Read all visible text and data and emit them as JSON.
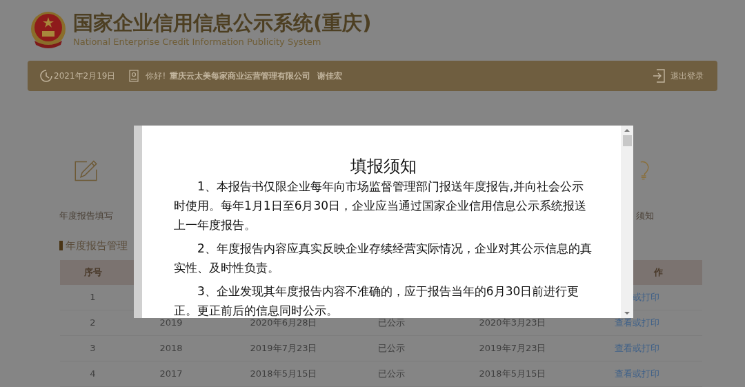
{
  "header": {
    "title": "国家企业信用信息公示系统(重庆)",
    "subtitle": "National Enterprise Credit Information Publicity System"
  },
  "user_bar": {
    "date": "2021年2月19日",
    "greeting": "你好!",
    "company": "重庆云太美每家商业运营管理有限公司",
    "person": "谢佳宏",
    "logout": "退出登录"
  },
  "shortcuts": [
    {
      "kind": "pencil",
      "label": "年度报告填写"
    },
    {
      "kind": "bulb",
      "label": "须知"
    }
  ],
  "section_title": "年度报告管理",
  "table": {
    "first_column": "序号",
    "last_column": "作",
    "rows": [
      {
        "no": "1",
        "year": "",
        "submitted": "",
        "status": "",
        "published": "",
        "action": "或打印"
      },
      {
        "no": "2",
        "year": "2019",
        "submitted": "2020年6月28日",
        "status": "已公示",
        "published": "2020年3月23日",
        "action": "查看或打印"
      },
      {
        "no": "3",
        "year": "2018",
        "submitted": "2019年7月23日",
        "status": "已公示",
        "published": "2019年7月23日",
        "action": "查看或打印"
      },
      {
        "no": "4",
        "year": "2017",
        "submitted": "2018年5月15日",
        "status": "已公示",
        "published": "2018年5月15日",
        "action": "查看或打印"
      }
    ]
  },
  "dialog": {
    "title": "填报须知",
    "paragraphs": [
      "1、本报告书仅限企业每年向市场监督管理部门报送年度报告,并向社会公示时使用。每年1月1日至6月30日，企业应当通过国家企业信用信息公示系统报送上一年度报告。",
      "2、年度报告内容应真实反映企业存续经营实际情况，企业对其公示信息的真实性、及时性负责。",
      "3、企业发现其年度报告内容不准确的，应于报告当年的6月30日前进行更正。更正前后的信息同时公示。"
    ]
  }
}
